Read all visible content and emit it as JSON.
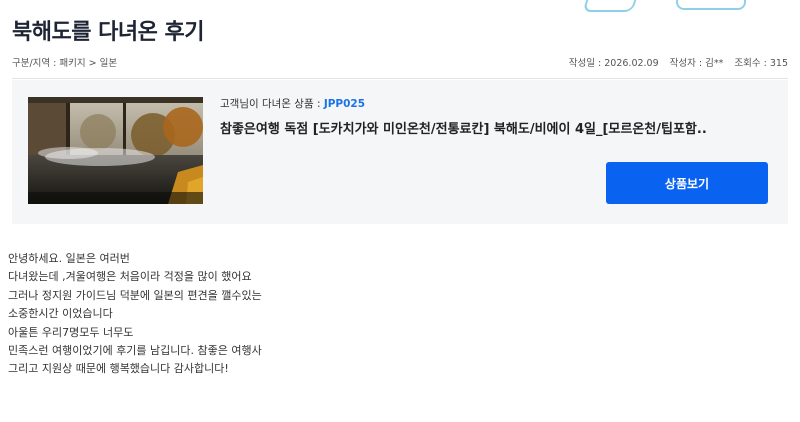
{
  "review": {
    "title": "북해도를 다녀온 후기",
    "breadcrumb": "구분/지역 : 패키지 > 일본",
    "meta": {
      "date": "작성일 : 2026.02.09",
      "author": "작성자 : 김**",
      "views": "조회수 : 315"
    },
    "body_lines": [
      "안녕하세요. 일본은 여러번",
      "다녀왔는데 ,겨울여행은  처음이라 걱정을 많이 했어요",
      "그러나 정지원 가이드님 덕분에 일본의 편견을 깰수있는",
      "소중한시간 이었습니다",
      "아울튼 우리7명모두 너무도",
      "민족스런 여행이었기에 후기를 남깁니다. 참좋은 여행사",
      "그리고 지원상 때문에 행복했습니다  감사합니다!"
    ]
  },
  "product": {
    "label": "고객님이 다녀온 상품 : ",
    "code": "JPP025",
    "name": "참좋은여행 독점 [도카치가와 미인온천/전통료칸] 북해도/비에이 4일_[모르온천/팁포함..",
    "button_label": "상품보기",
    "image_icon": "onsen-photo"
  },
  "colors": {
    "accent": "#0a62f0",
    "code": "#1a73e8",
    "box_bg": "#f5f6f8"
  }
}
